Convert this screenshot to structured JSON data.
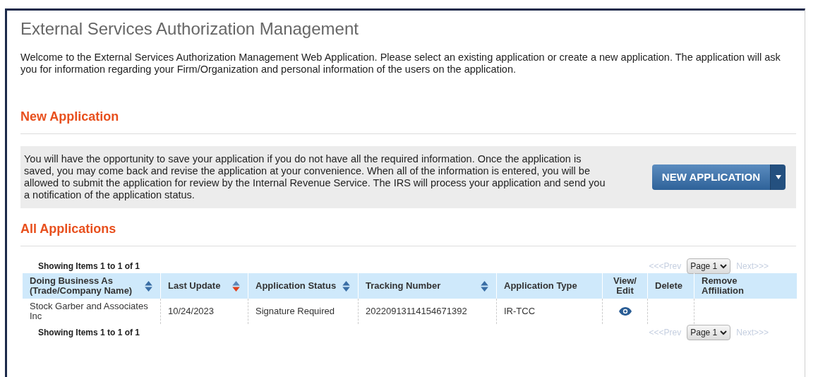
{
  "title": "External Services Authorization Management",
  "intro": "Welcome to the External Services Authorization Management Web Application. Please select an existing application or create a new application. The application will ask you for information regarding your Firm/Organization and personal information of the users on the application.",
  "new_application": {
    "heading": "New Application",
    "text": "You will have the opportunity to save your application if you do not have all the required information. Once the application is saved, you may come back and revise the application at your convenience. When all of the information is entered, you will be allowed to submit the application for review by the Internal Revenue Service. The IRS will process your application and send you a notification of the application status.",
    "button": "NEW APPLICATION"
  },
  "all_applications": {
    "heading": "All Applications",
    "showing_top": "Showing Items 1 to 1 of 1",
    "showing_bottom": "Showing Items 1 to 1 of 1",
    "pager_top": {
      "prev": "<<<Prev",
      "page": "Page 1",
      "next": "Next>>>",
      "prev_disabled": true,
      "next_disabled": true
    },
    "pager_bottom": {
      "prev": "<<<Prev",
      "page": "Page 1",
      "next": "Next>>>",
      "prev_disabled": true,
      "next_disabled": true
    },
    "columns": [
      {
        "label": "Doing Business As (Trade/Company Name)",
        "sortable": true,
        "sorted_desc": false
      },
      {
        "label": "Last Update",
        "sortable": true,
        "sorted_desc": true
      },
      {
        "label": "Application Status",
        "sortable": true,
        "sorted_desc": false
      },
      {
        "label": "Tracking Number",
        "sortable": true,
        "sorted_desc": false
      },
      {
        "label": "Application Type",
        "sortable": false
      },
      {
        "label": "View/ Edit",
        "sortable": false
      },
      {
        "label": "Delete",
        "sortable": false
      },
      {
        "label": "Remove Affiliation",
        "sortable": false
      }
    ],
    "rows": [
      {
        "cells": [
          {
            "kind": "text",
            "text": "Stock Garber and Associates Inc"
          },
          {
            "kind": "text",
            "text": "10/24/2023"
          },
          {
            "kind": "text",
            "text": "Signature Required"
          },
          {
            "kind": "text",
            "text": "20220913114154671392"
          },
          {
            "kind": "text",
            "text": "IR-TCC"
          },
          {
            "kind": "view"
          },
          {
            "kind": "empty"
          },
          {
            "kind": "empty"
          }
        ]
      }
    ]
  }
}
